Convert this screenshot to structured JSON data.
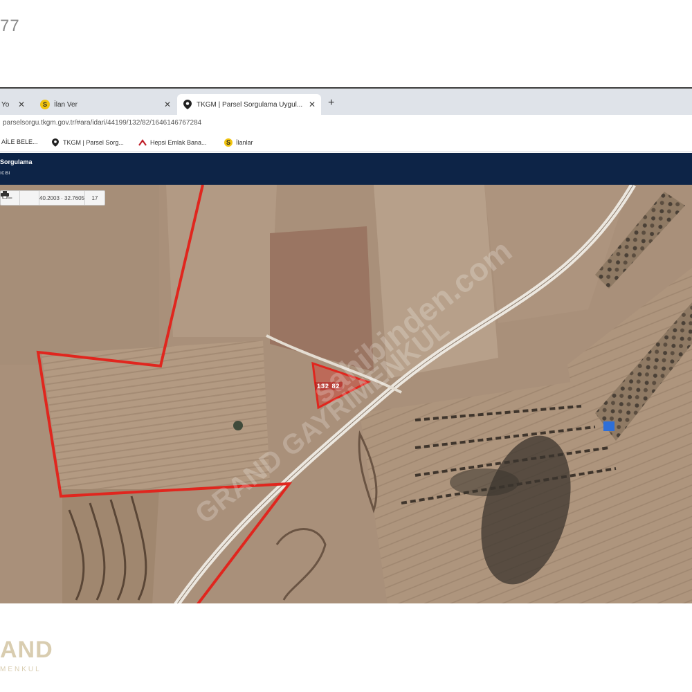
{
  "listing_id": "77",
  "browser": {
    "tabs": [
      {
        "label": "Yo",
        "active": false
      },
      {
        "label": "İlan Ver",
        "active": false
      },
      {
        "label": "TKGM | Parsel Sorgulama Uygul...",
        "active": true
      }
    ],
    "new_tab_label": "+",
    "url": "parselsorgu.tkgm.gov.tr/#ara/idari/44199/132/82/1646146767284",
    "bookmarks": [
      {
        "label": "AİLE BELE...",
        "icon": "bookmark-icon"
      },
      {
        "label": "TKGM | Parsel Sorg...",
        "icon": "map-pin-icon"
      },
      {
        "label": "Hepsi Emlak Bana...",
        "icon": "hepsiemlak-icon"
      },
      {
        "label": "İlanlar",
        "icon": "sahibinden-icon"
      }
    ]
  },
  "app": {
    "title": "Sorgulama",
    "subtitle": "ıcısı"
  },
  "map": {
    "toolbar": {
      "zoom_out": "−",
      "print": "print-icon",
      "coordinates": "40.2003 · 32.7605",
      "zoom_level": "17"
    },
    "parcel_label": "132 82",
    "watermarks": [
      "sahibinden.com",
      "GRAND GAYRIMENKUL"
    ]
  },
  "brand": {
    "name": "AND",
    "sub": "MENKUL"
  },
  "colors": {
    "header_bg": "#0d2447",
    "tabstrip_bg": "#dfe3e9",
    "parcel_outline": "#e0261e",
    "road": "#e8e4dc",
    "brand": "#d9cdb0"
  }
}
